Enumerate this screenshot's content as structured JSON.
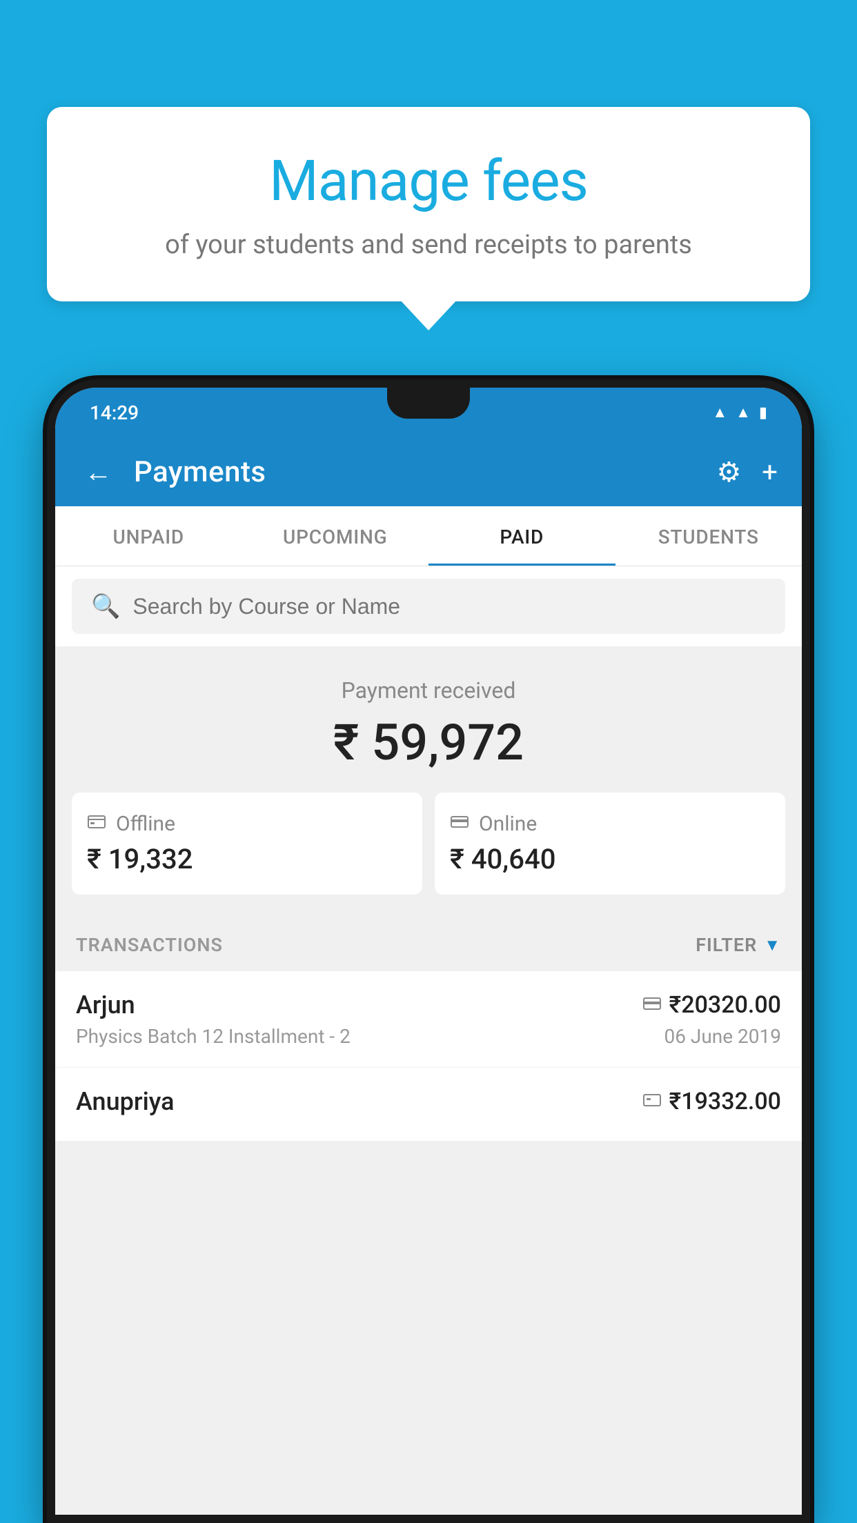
{
  "background_color": "#1AACE0",
  "speech_bubble": {
    "heading": "Manage fees",
    "subtext": "of your students and send receipts to parents"
  },
  "phone": {
    "status_bar": {
      "time": "14:29",
      "wifi_icon": "wifi",
      "signal_icon": "signal",
      "battery_icon": "battery"
    },
    "app_bar": {
      "title": "Payments",
      "back_label": "←",
      "gear_label": "⚙",
      "plus_label": "+"
    },
    "tabs": [
      {
        "id": "unpaid",
        "label": "UNPAID",
        "active": false
      },
      {
        "id": "upcoming",
        "label": "UPCOMING",
        "active": false
      },
      {
        "id": "paid",
        "label": "PAID",
        "active": true
      },
      {
        "id": "students",
        "label": "STUDENTS",
        "active": false
      }
    ],
    "search": {
      "placeholder": "Search by Course or Name"
    },
    "payment_summary": {
      "label": "Payment received",
      "amount": "₹ 59,972",
      "offline": {
        "icon": "offline",
        "type": "Offline",
        "amount": "₹ 19,332"
      },
      "online": {
        "icon": "online",
        "type": "Online",
        "amount": "₹ 40,640"
      }
    },
    "transactions": {
      "header_label": "TRANSACTIONS",
      "filter_label": "FILTER",
      "rows": [
        {
          "name": "Arjun",
          "amount_icon": "card",
          "amount": "₹20320.00",
          "course": "Physics Batch 12 Installment - 2",
          "date": "06 June 2019"
        },
        {
          "name": "Anupriya",
          "amount_icon": "cash",
          "amount": "₹19332.00",
          "course": "",
          "date": ""
        }
      ]
    }
  }
}
